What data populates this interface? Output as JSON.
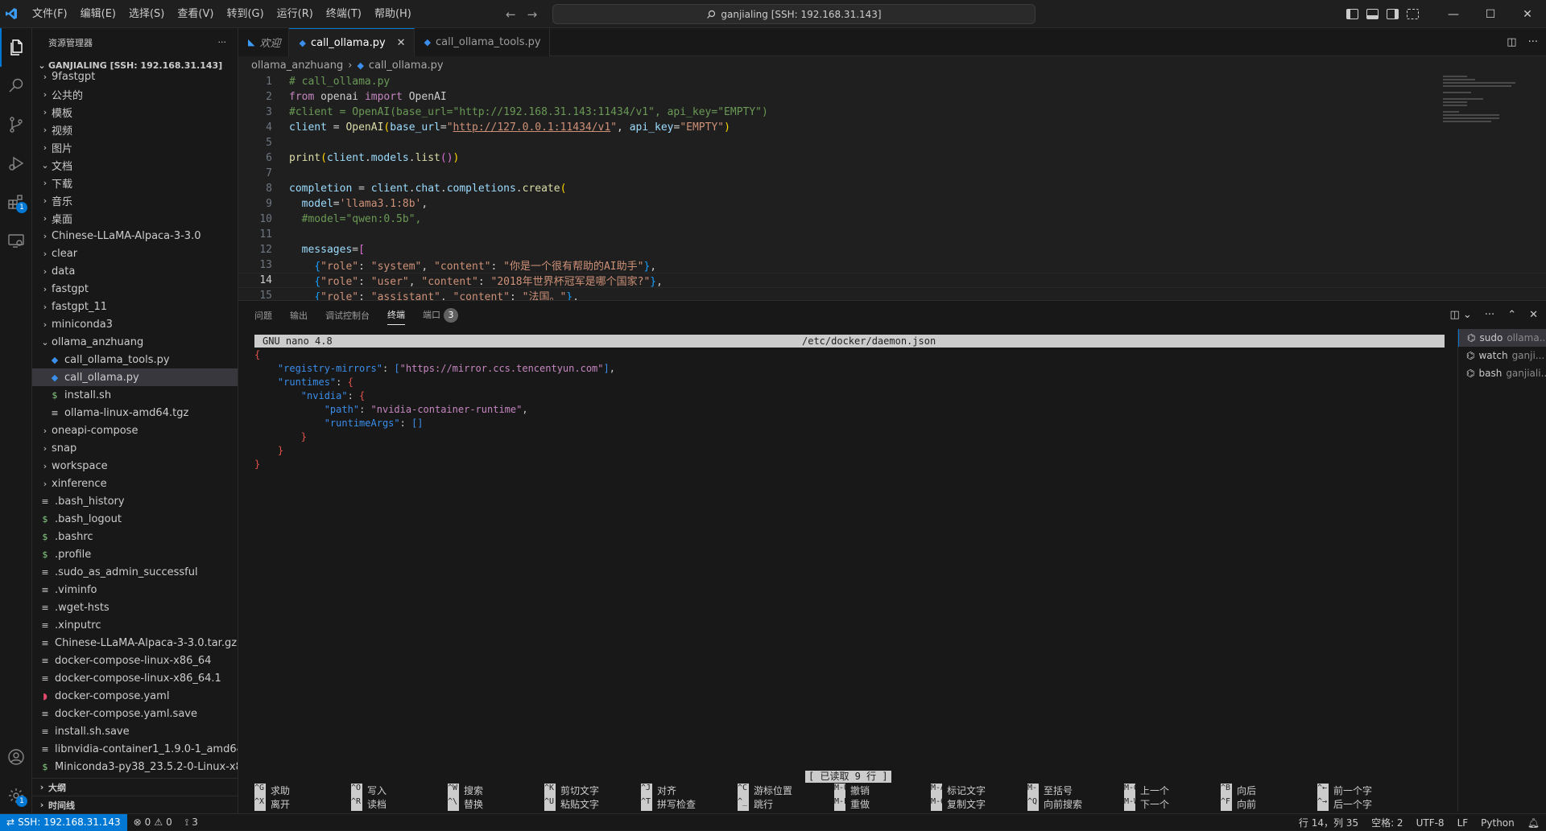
{
  "titlebar": {
    "menu": [
      "文件(F)",
      "编辑(E)",
      "选择(S)",
      "查看(V)",
      "转到(G)",
      "运行(R)",
      "终端(T)",
      "帮助(H)"
    ],
    "command_center": "ganjialing [SSH: 192.168.31.143]"
  },
  "activitybar": {
    "extensions_badge": "1",
    "settings_badge": "1"
  },
  "sidebar": {
    "title": "资源管理器",
    "more": "···",
    "section": "GANJIALING [SSH: 192.168.31.143]",
    "items": [
      {
        "label": "9fastgpt",
        "type": "folder",
        "indent": 1,
        "open": false
      },
      {
        "label": "公共的",
        "type": "folder",
        "indent": 1,
        "open": false
      },
      {
        "label": "模板",
        "type": "folder",
        "indent": 1,
        "open": false
      },
      {
        "label": "视频",
        "type": "folder",
        "indent": 1,
        "open": false
      },
      {
        "label": "图片",
        "type": "folder",
        "indent": 1,
        "open": false
      },
      {
        "label": "文档",
        "type": "folder",
        "indent": 1,
        "open": true
      },
      {
        "label": "下载",
        "type": "folder",
        "indent": 1,
        "open": false
      },
      {
        "label": "音乐",
        "type": "folder",
        "indent": 1,
        "open": false
      },
      {
        "label": "桌面",
        "type": "folder",
        "indent": 1,
        "open": false
      },
      {
        "label": "Chinese-LLaMA-Alpaca-3-3.0",
        "type": "folder",
        "indent": 1,
        "open": false
      },
      {
        "label": "clear",
        "type": "folder",
        "indent": 1,
        "open": false
      },
      {
        "label": "data",
        "type": "folder",
        "indent": 1,
        "open": false
      },
      {
        "label": "fastgpt",
        "type": "folder",
        "indent": 1,
        "open": false
      },
      {
        "label": "fastgpt_11",
        "type": "folder",
        "indent": 1,
        "open": false
      },
      {
        "label": "miniconda3",
        "type": "folder",
        "indent": 1,
        "open": false
      },
      {
        "label": "ollama_anzhuang",
        "type": "folder",
        "indent": 1,
        "open": true
      },
      {
        "label": "call_ollama_tools.py",
        "type": "py",
        "indent": 2
      },
      {
        "label": "call_ollama.py",
        "type": "py",
        "indent": 2,
        "selected": true
      },
      {
        "label": "install.sh",
        "type": "sh",
        "indent": 2
      },
      {
        "label": "ollama-linux-amd64.tgz",
        "type": "txt",
        "indent": 2
      },
      {
        "label": "oneapi-compose",
        "type": "folder",
        "indent": 1,
        "open": false
      },
      {
        "label": "snap",
        "type": "folder",
        "indent": 1,
        "open": false
      },
      {
        "label": "workspace",
        "type": "folder",
        "indent": 1,
        "open": false
      },
      {
        "label": "xinference",
        "type": "folder",
        "indent": 1,
        "open": false
      },
      {
        "label": ".bash_history",
        "type": "txt",
        "indent": 1
      },
      {
        "label": ".bash_logout",
        "type": "sh",
        "indent": 1
      },
      {
        "label": ".bashrc",
        "type": "sh",
        "indent": 1
      },
      {
        "label": ".profile",
        "type": "sh",
        "indent": 1
      },
      {
        "label": ".sudo_as_admin_successful",
        "type": "txt",
        "indent": 1
      },
      {
        "label": ".viminfo",
        "type": "txt",
        "indent": 1
      },
      {
        "label": ".wget-hsts",
        "type": "txt",
        "indent": 1
      },
      {
        "label": ".xinputrc",
        "type": "txt",
        "indent": 1
      },
      {
        "label": "Chinese-LLaMA-Alpaca-3-3.0.tar.gz",
        "type": "txt",
        "indent": 1
      },
      {
        "label": "docker-compose-linux-x86_64",
        "type": "txt",
        "indent": 1
      },
      {
        "label": "docker-compose-linux-x86_64.1",
        "type": "txt",
        "indent": 1
      },
      {
        "label": "docker-compose.yaml",
        "type": "dock",
        "indent": 1
      },
      {
        "label": "docker-compose.yaml.save",
        "type": "txt",
        "indent": 1
      },
      {
        "label": "install.sh.save",
        "type": "txt",
        "indent": 1
      },
      {
        "label": "libnvidia-container1_1.9.0-1_amd64...",
        "type": "txt",
        "indent": 1
      },
      {
        "label": "Miniconda3-py38_23.5.2-0-Linux-x8...",
        "type": "sh",
        "indent": 1
      }
    ],
    "outline": "大纲",
    "timeline": "时间线"
  },
  "tabs": [
    {
      "label": "欢迎",
      "kind": "welcome"
    },
    {
      "label": "call_ollama.py",
      "kind": "py",
      "active": true
    },
    {
      "label": "call_ollama_tools.py",
      "kind": "py"
    }
  ],
  "breadcrumb": [
    "ollama_anzhuang",
    "call_ollama.py"
  ],
  "code": [
    [
      [
        "cm",
        "# call_ollama.py"
      ]
    ],
    [
      [
        "kw",
        "from"
      ],
      [
        "plain",
        " openai "
      ],
      [
        "kw",
        "import"
      ],
      [
        "plain",
        " OpenAI"
      ]
    ],
    [
      [
        "cm",
        "#client = OpenAI(base_url=\"http://192.168.31.143:11434/v1\", api_key=\"EMPTY\")"
      ]
    ],
    [
      [
        "var",
        "client"
      ],
      [
        "plain",
        " = "
      ],
      [
        "fn",
        "OpenAI"
      ],
      [
        "br1",
        "("
      ],
      [
        "var",
        "base_url"
      ],
      [
        "plain",
        "="
      ],
      [
        "str",
        "\""
      ],
      [
        "url",
        "http://127.0.0.1:11434/v1"
      ],
      [
        "str",
        "\""
      ],
      [
        "plain",
        ", "
      ],
      [
        "var",
        "api_key"
      ],
      [
        "plain",
        "="
      ],
      [
        "str",
        "\"EMPTY\""
      ],
      [
        "br1",
        ")"
      ]
    ],
    [],
    [
      [
        "fn",
        "print"
      ],
      [
        "br1",
        "("
      ],
      [
        "var",
        "client"
      ],
      [
        "plain",
        "."
      ],
      [
        "var",
        "models"
      ],
      [
        "plain",
        "."
      ],
      [
        "fn",
        "list"
      ],
      [
        "br2",
        "()"
      ],
      [
        "br1",
        ")"
      ]
    ],
    [],
    [
      [
        "var",
        "completion"
      ],
      [
        "plain",
        " = "
      ],
      [
        "var",
        "client"
      ],
      [
        "plain",
        "."
      ],
      [
        "var",
        "chat"
      ],
      [
        "plain",
        "."
      ],
      [
        "var",
        "completions"
      ],
      [
        "plain",
        "."
      ],
      [
        "fn",
        "create"
      ],
      [
        "br1",
        "("
      ]
    ],
    [
      [
        "plain",
        "  "
      ],
      [
        "var",
        "model"
      ],
      [
        "plain",
        "="
      ],
      [
        "str",
        "'llama3.1:8b'"
      ],
      [
        "plain",
        ","
      ]
    ],
    [
      [
        "plain",
        "  "
      ],
      [
        "cm",
        "#model=\"qwen:0.5b\","
      ]
    ],
    [],
    [
      [
        "plain",
        "  "
      ],
      [
        "var",
        "messages"
      ],
      [
        "plain",
        "="
      ],
      [
        "br2",
        "["
      ]
    ],
    [
      [
        "plain",
        "    "
      ],
      [
        "br3",
        "{"
      ],
      [
        "str",
        "\"role\""
      ],
      [
        "plain",
        ": "
      ],
      [
        "str",
        "\"system\""
      ],
      [
        "plain",
        ", "
      ],
      [
        "str",
        "\"content\""
      ],
      [
        "plain",
        ": "
      ],
      [
        "str",
        "\"你是一个很有帮助的AI助手\""
      ],
      [
        "br3",
        "}"
      ],
      [
        "plain",
        ","
      ]
    ],
    [
      [
        "plain",
        "    "
      ],
      [
        "br3",
        "{"
      ],
      [
        "str",
        "\"role\""
      ],
      [
        "plain",
        ": "
      ],
      [
        "str",
        "\"user\""
      ],
      [
        "plain",
        ", "
      ],
      [
        "str",
        "\"content\""
      ],
      [
        "plain",
        ": "
      ],
      [
        "str",
        "\"2018年世界杯冠军是哪个国家?\""
      ],
      [
        "br3",
        "}"
      ],
      [
        "plain",
        ","
      ]
    ],
    [
      [
        "plain",
        "    "
      ],
      [
        "br3",
        "{"
      ],
      [
        "str",
        "\"role\""
      ],
      [
        "plain",
        ": "
      ],
      [
        "str",
        "\"assistant\""
      ],
      [
        "plain",
        ", "
      ],
      [
        "str",
        "\"content\""
      ],
      [
        "plain",
        ": "
      ],
      [
        "str",
        "\"法国。\""
      ],
      [
        "br3",
        "}"
      ],
      [
        "plain",
        ","
      ]
    ]
  ],
  "current_line": 14,
  "panel": {
    "tabs": [
      "问题",
      "输出",
      "调试控制台",
      "终端",
      "端口"
    ],
    "active_tab": "终端",
    "ports_count": "3"
  },
  "nano": {
    "version": "GNU nano 4.8",
    "filename": "/etc/docker/daemon.json",
    "status": "[ 已读取 9 行 ]",
    "lines": [
      [
        [
          "jbr",
          "{"
        ]
      ],
      [
        [
          "jsep",
          "    "
        ],
        [
          "jkey",
          "\"registry-mirrors\""
        ],
        [
          "jsep",
          ": "
        ],
        [
          "jarr",
          "["
        ],
        [
          "jstr",
          "\"https://mirror.ccs.tencentyun.com\""
        ],
        [
          "jarr",
          "]"
        ],
        [
          "jsep",
          ","
        ]
      ],
      [
        [
          "jsep",
          "    "
        ],
        [
          "jkey",
          "\"runtimes\""
        ],
        [
          "jsep",
          ": "
        ],
        [
          "jbr",
          "{"
        ]
      ],
      [
        [
          "jsep",
          "        "
        ],
        [
          "jkey",
          "\"nvidia\""
        ],
        [
          "jsep",
          ": "
        ],
        [
          "jbr",
          "{"
        ]
      ],
      [
        [
          "jsep",
          "            "
        ],
        [
          "jkey",
          "\"path\""
        ],
        [
          "jsep",
          ": "
        ],
        [
          "jstr",
          "\"nvidia-container-runtime\""
        ],
        [
          "jsep",
          ","
        ]
      ],
      [
        [
          "jsep",
          "            "
        ],
        [
          "jkey",
          "\"runtimeArgs\""
        ],
        [
          "jsep",
          ": "
        ],
        [
          "jarr",
          "[]"
        ]
      ],
      [
        [
          "jsep",
          "        "
        ],
        [
          "jbr",
          "}"
        ]
      ],
      [
        [
          "jsep",
          "    "
        ],
        [
          "jbr",
          "}"
        ]
      ],
      [
        [
          "jbr",
          "}"
        ]
      ]
    ],
    "shortcuts_row1": [
      [
        "^G",
        "求助"
      ],
      [
        "^O",
        "写入"
      ],
      [
        "^W",
        "搜索"
      ],
      [
        "^K",
        "剪切文字"
      ],
      [
        "^J",
        "对齐"
      ],
      [
        "^C",
        "游标位置"
      ],
      [
        "M-U",
        "撤销"
      ],
      [
        "M-A",
        "标记文字"
      ],
      [
        "M-]",
        "至括号"
      ],
      [
        "M-Q",
        "上一个"
      ],
      [
        "^B",
        "向后"
      ],
      [
        "^←",
        "前一个字"
      ]
    ],
    "shortcuts_row2": [
      [
        "^X",
        "离开"
      ],
      [
        "^R",
        "读档"
      ],
      [
        "^\\",
        "替换"
      ],
      [
        "^U",
        "粘贴文字"
      ],
      [
        "^T",
        "拼写检查"
      ],
      [
        "^_",
        "跳行"
      ],
      [
        "M-E",
        "重做"
      ],
      [
        "M-6",
        "复制文字"
      ],
      [
        "^Q",
        "向前搜索"
      ],
      [
        "M-W",
        "下一个"
      ],
      [
        "^F",
        "向前"
      ],
      [
        "^→",
        "后一个字"
      ]
    ]
  },
  "terminals": [
    {
      "name": "sudo",
      "sub": "ollama..."
    },
    {
      "name": "watch",
      "sub": "ganji..."
    },
    {
      "name": "bash",
      "sub": "ganjiali..."
    }
  ],
  "statusbar": {
    "remote": "SSH: 192.168.31.143",
    "errors": "0",
    "warnings": "0",
    "ports": "3",
    "position": "行 14，列 35",
    "spaces": "空格: 2",
    "encoding": "UTF-8",
    "eol": "LF",
    "language": "Python"
  }
}
